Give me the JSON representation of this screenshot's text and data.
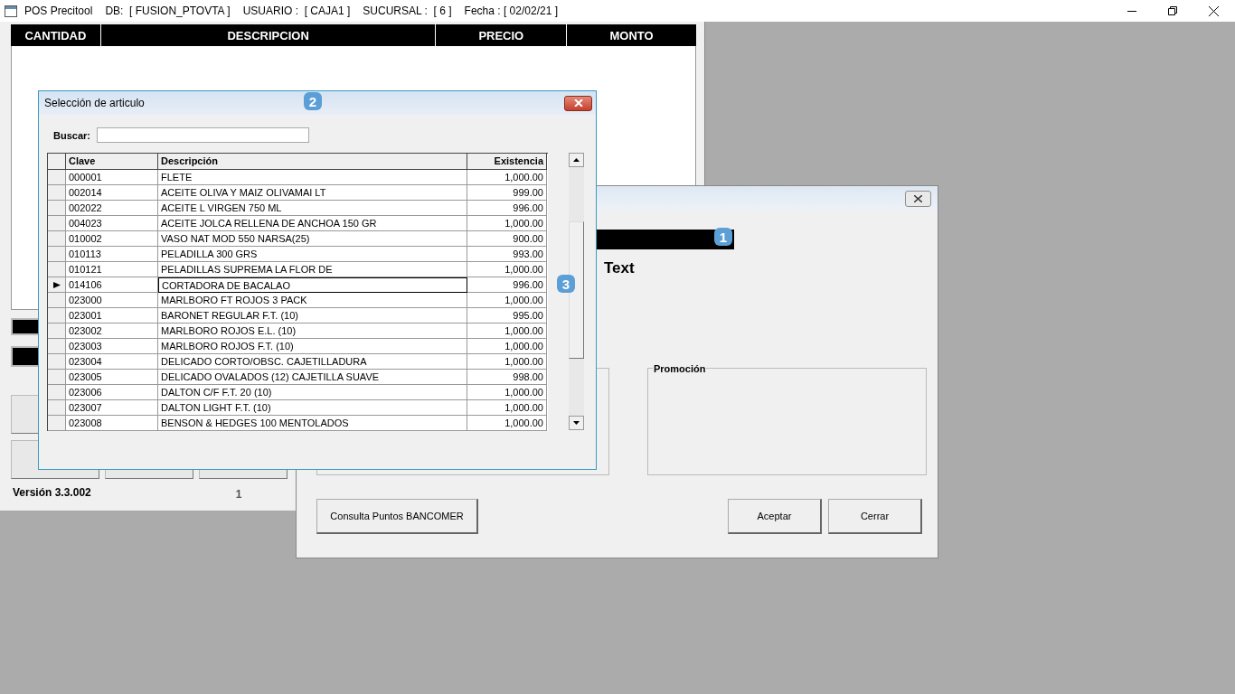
{
  "title_bar": {
    "items": [
      "POS Precitool",
      "DB:  [ FUSION_PTOVTA ]",
      "USUARIO :  [ CAJA1 ]",
      "SUCURSAL :  [ 6 ]",
      "Fecha : [ 02/02/21 ]"
    ]
  },
  "main_window": {
    "columns": [
      "CANTIDAD",
      "DESCRIPCION",
      "PRECIO",
      "MONTO"
    ],
    "version": "Versión 3.3.002",
    "counter": "1"
  },
  "payment_dialog": {
    "badge": "1",
    "label": "Text",
    "group": "Promoción",
    "buttons": [
      {
        "label": "Consulta Puntos BANCOMER"
      },
      {
        "label": "Aceptar"
      },
      {
        "label": "Cerrar"
      }
    ]
  },
  "article_dialog": {
    "title": "Selección de articulo",
    "badge": "2",
    "search": {
      "label": "Buscar:"
    },
    "row_badge": "3",
    "table": {
      "columns": [
        "Clave",
        "Descripción",
        "Existencia"
      ],
      "rows": [
        {
          "clave": "000001",
          "descripcion": "FLETE",
          "existencia": "1,000.00",
          "selected": false
        },
        {
          "clave": "002014",
          "descripcion": "ACEITE OLIVA Y MAIZ OLIVAMAI LT",
          "existencia": "999.00",
          "selected": false
        },
        {
          "clave": "002022",
          "descripcion": "ACEITE L VIRGEN 750 ML",
          "existencia": "996.00",
          "selected": false
        },
        {
          "clave": "004023",
          "descripcion": "ACEITE JOLCA RELLENA DE ANCHOA 150 GR",
          "existencia": "1,000.00",
          "selected": false
        },
        {
          "clave": "010002",
          "descripcion": "VASO NAT MOD 550 NARSA(25)",
          "existencia": "900.00",
          "selected": false
        },
        {
          "clave": "010113",
          "descripcion": "PELADILLA 300 GRS",
          "existencia": "993.00",
          "selected": false
        },
        {
          "clave": "010121",
          "descripcion": "PELADILLAS SUPREMA LA FLOR DE",
          "existencia": "1,000.00",
          "selected": false
        },
        {
          "clave": "014106",
          "descripcion": "CORTADORA DE BACALAO",
          "existencia": "996.00",
          "selected": true
        },
        {
          "clave": "023000",
          "descripcion": "MARLBORO FT ROJOS 3 PACK",
          "existencia": "1,000.00",
          "selected": false
        },
        {
          "clave": "023001",
          "descripcion": "BARONET REGULAR F.T. (10)",
          "existencia": "995.00",
          "selected": false
        },
        {
          "clave": "023002",
          "descripcion": "MARLBORO ROJOS E.L. (10)",
          "existencia": "1,000.00",
          "selected": false
        },
        {
          "clave": "023003",
          "descripcion": "MARLBORO ROJOS F.T. (10)",
          "existencia": "1,000.00",
          "selected": false
        },
        {
          "clave": "023004",
          "descripcion": "DELICADO CORTO/OBSC. CAJETILLADURA",
          "existencia": "1,000.00",
          "selected": false
        },
        {
          "clave": "023005",
          "descripcion": "DELICADO OVALADOS (12) CAJETILLA SUAVE",
          "existencia": "998.00",
          "selected": false
        },
        {
          "clave": "023006",
          "descripcion": "DALTON C/F F.T. 20 (10)",
          "existencia": "1,000.00",
          "selected": false
        },
        {
          "clave": "023007",
          "descripcion": "DALTON LIGHT F.T. (10)",
          "existencia": "1,000.00",
          "selected": false
        },
        {
          "clave": "023008",
          "descripcion": "BENSON & HEDGES 100 MENTOLADOS",
          "existencia": "1,000.00",
          "selected": false
        }
      ]
    }
  }
}
